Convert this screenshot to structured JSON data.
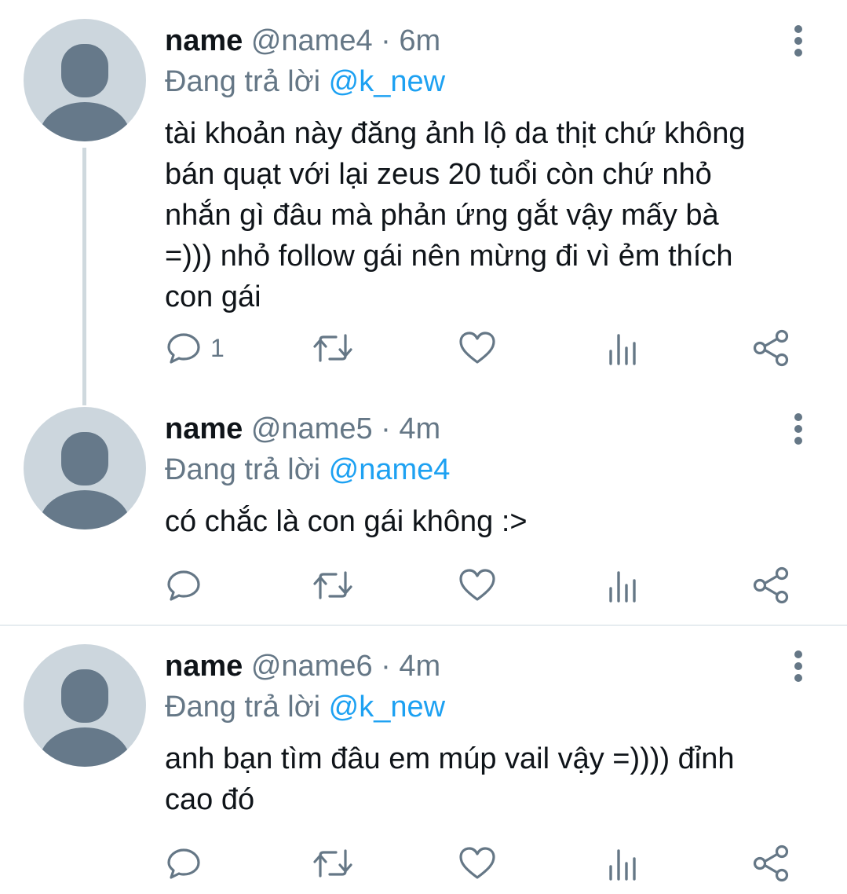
{
  "colors": {
    "text": "#0f1419",
    "muted": "#657786",
    "mention": "#1da1f2",
    "avatar_bg": "#ccd6dd",
    "avatar_fg": "#66798a"
  },
  "icons": {
    "reply": "speech-bubble",
    "retweet": "retweet-arrows",
    "like": "heart-outline",
    "analytics": "bar-chart",
    "share": "share-nodes",
    "more": "vertical-ellipsis"
  },
  "tweets": [
    {
      "name": "name",
      "handle": "@name4",
      "time": " · 6m",
      "reply_prefix": "Đang trả lời ",
      "reply_to": "@k_new",
      "text": "tài khoản này đăng ảnh lộ da thịt chứ không\nbán quạt với lại zeus 20 tuổi còn chứ nhỏ\nnhắn gì đâu mà phản ứng gắt vậy mấy bà\n=))) nhỏ follow gái nên mừng đi vì ẻm thích\ncon gái",
      "reply_count": "1"
    },
    {
      "name": "name",
      "handle": "@name5",
      "time": " · 4m",
      "reply_prefix": "Đang trả lời ",
      "reply_to": "@name4",
      "text": "có chắc là con gái không :>",
      "reply_count": ""
    },
    {
      "name": "name",
      "handle": "@name6",
      "time": " · 4m",
      "reply_prefix": "Đang trả lời ",
      "reply_to": "@k_new",
      "text": "anh bạn tìm đâu em múp vail vậy =)))) đỉnh\ncao đó",
      "reply_count": ""
    }
  ]
}
